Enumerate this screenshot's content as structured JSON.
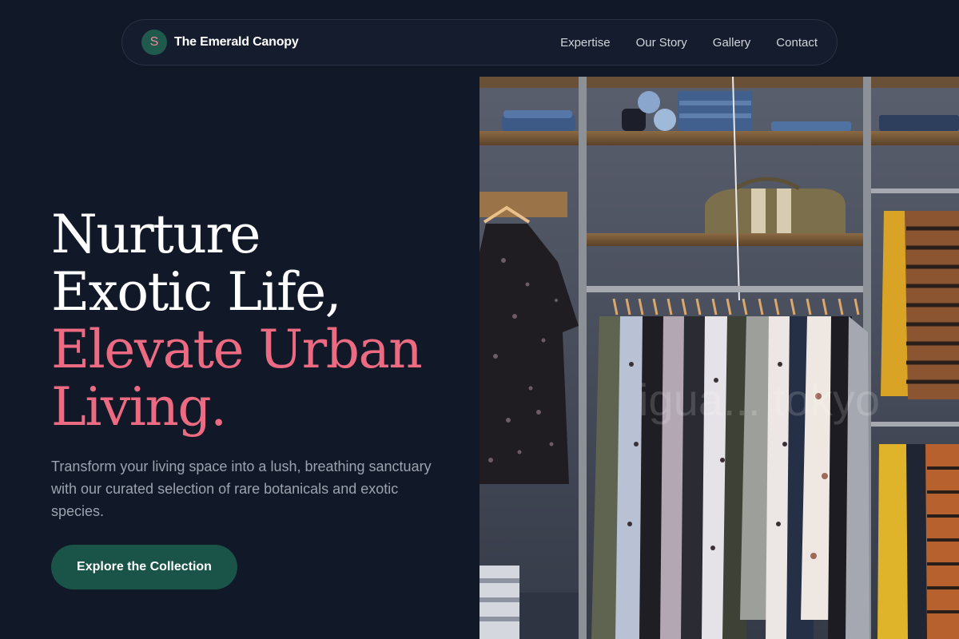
{
  "nav": {
    "logo_letter": "S",
    "brand": "The Emerald Canopy",
    "links": [
      "Expertise",
      "Our Story",
      "Gallery",
      "Contact"
    ]
  },
  "hero": {
    "headline_lines": [
      "Nurture",
      "Exotic Life,"
    ],
    "accent_lines": [
      "Elevate Urban",
      "Living."
    ],
    "subtitle": "Transform your living space into a lush, breathing sanctuary with our curated selection of rare botanicals and exotic species.",
    "cta": "Explore the Collection"
  },
  "image": {
    "watermark": "igua... tokyo"
  },
  "colors": {
    "background": "#111827",
    "accent_pink": "#ec6b82",
    "accent_green": "#1a5448"
  }
}
